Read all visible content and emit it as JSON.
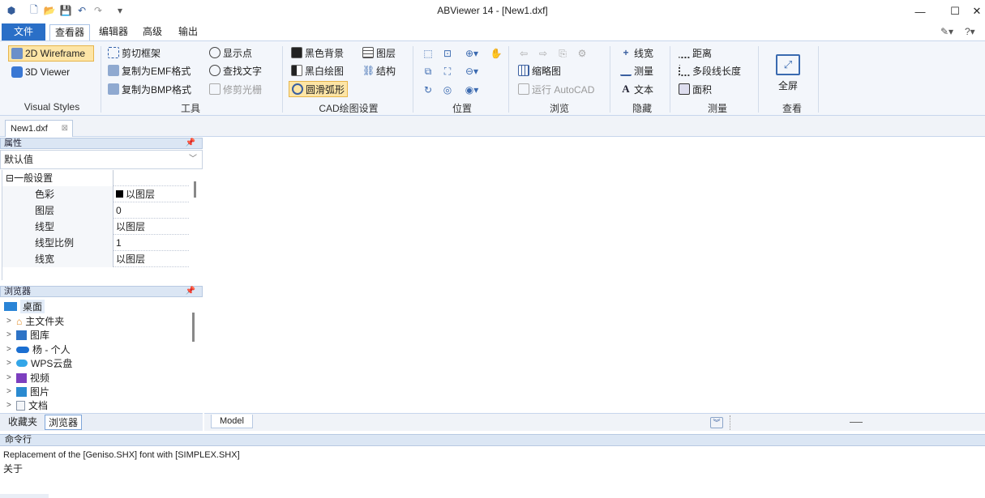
{
  "window": {
    "title": "ABViewer 14 - [New1.dxf]",
    "minimize": "—",
    "maximize": "☐",
    "close": "✕"
  },
  "menu": {
    "file": "文件",
    "tabs": [
      "查看器",
      "编辑器",
      "高级",
      "输出"
    ]
  },
  "ribbon": {
    "visual_styles": {
      "label": "Visual Styles",
      "items": [
        "2D Wireframe",
        "3D Viewer"
      ]
    },
    "tools": {
      "label": "工具",
      "items": [
        "剪切框架",
        "复制为EMF格式",
        "复制为BMP格式",
        "显示点",
        "查找文字",
        "修剪光栅"
      ]
    },
    "cad_settings": {
      "label": "CAD绘图设置",
      "items": [
        "黑色背景",
        "黑白绘图",
        "圆滑弧形",
        "图层",
        "结构"
      ]
    },
    "position": {
      "label": "位置"
    },
    "browse": {
      "label": "浏览",
      "items": [
        "缩略图",
        "运行 AutoCAD"
      ]
    },
    "hide": {
      "label": "隐藏",
      "items": [
        "线宽",
        "测量",
        "文本"
      ]
    },
    "measure": {
      "label": "测量",
      "items": [
        "距离",
        "多段线长度",
        "面积"
      ]
    },
    "view": {
      "label": "查看",
      "items": [
        "全屏"
      ]
    }
  },
  "doc_tab": "New1.dxf",
  "properties": {
    "header": "属性",
    "selector": "默认值",
    "group": "一般设置",
    "rows": [
      {
        "key": "色彩",
        "value": "以图层"
      },
      {
        "key": "图层",
        "value": "0"
      },
      {
        "key": "线型",
        "value": "以图层"
      },
      {
        "key": "线型比例",
        "value": "1"
      },
      {
        "key": "线宽",
        "value": "以图层"
      }
    ]
  },
  "browser": {
    "header": "浏览器",
    "root": "桌面",
    "items": [
      "主文件夹",
      "图库",
      "杨 - 个人",
      "WPS云盘",
      "视频",
      "图片",
      "文档"
    ],
    "tabs": [
      "收藏夹",
      "浏览器"
    ]
  },
  "model_tab": "Model",
  "command": {
    "header": "命令行",
    "lines": [
      "Replacement of the [Geniso.SHX] font with [SIMPLEX.SHX]",
      "关于"
    ]
  },
  "colors": {
    "accent": "#2a6fc7",
    "ribbon_bg": "#f3f6fb",
    "panel_header": "#dbe6f4",
    "active_style": "#fde5a6"
  }
}
